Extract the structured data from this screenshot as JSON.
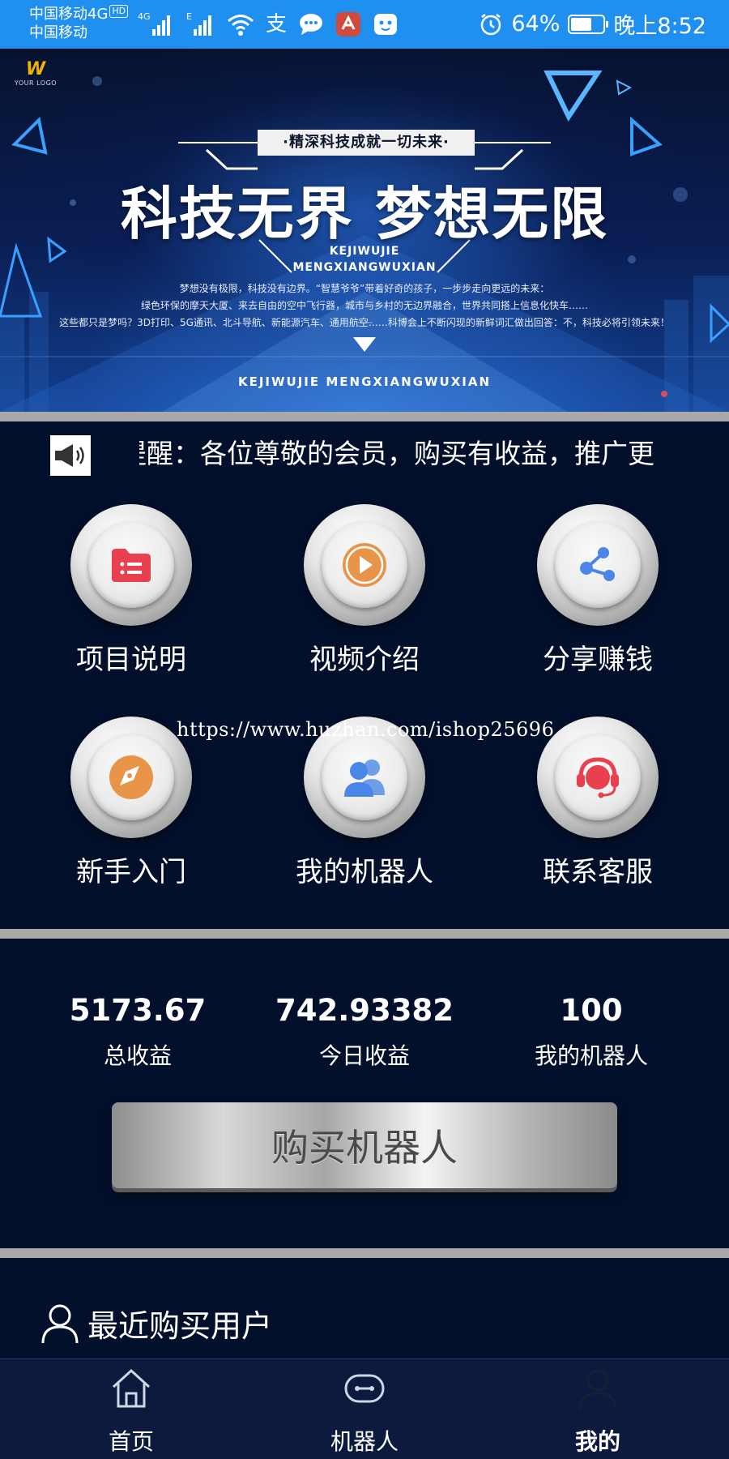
{
  "status_bar": {
    "carrier_1": "中国移动4G",
    "hd_badge": "HD",
    "carrier_2": "中国移动",
    "net_tag_1": "4G",
    "net_tag_2": "E",
    "alipay_glyph": "支",
    "battery_text": "64%",
    "battery_level": 0.64,
    "time": "晚上8:52"
  },
  "banner": {
    "logo_text": "YOUR LOGO",
    "tag": "·精深科技成就一切未来·",
    "title": "科技无界 梦想无限",
    "pinyin_1": "KEJIWUJIE",
    "pinyin_2": "MENGXIANGWUXIAN",
    "desc_1": "梦想没有极限，科技没有边界。“智慧爷爷”带着好奇的孩子，一步步走向更远的未来：",
    "desc_2": "绿色环保的摩天大厦、来去自由的空中飞行器，城市与乡村的无边界融合，世界共同搭上信息化快车……",
    "desc_3": "这些都只是梦吗？3D打印、5G通讯、北斗导航、新能源汽车、通用航空……科博会上不断闪现的新鲜词汇做出回答：不，科技必将引领未来！",
    "footer": "KEJIWUJIE MENGXIANGWUXIAN"
  },
  "notice": {
    "icon": "megaphone-icon",
    "text": "提醒：各位尊敬的会员，购买有收益，推广更"
  },
  "menu": [
    {
      "label": "项目说明",
      "icon": "folder-list-icon",
      "color": "#e8404f"
    },
    {
      "label": "视频介绍",
      "icon": "play-icon",
      "color": "#e8954a"
    },
    {
      "label": "分享赚钱",
      "icon": "share-icon",
      "color": "#4a86e8"
    },
    {
      "label": "新手入门",
      "icon": "compass-icon",
      "color": "#e8954a"
    },
    {
      "label": "我的机器人",
      "icon": "users-icon",
      "color": "#4a86e8"
    },
    {
      "label": "联系客服",
      "icon": "headset-icon",
      "color": "#e8404f"
    }
  ],
  "watermark": "https://www.huzhan.com/ishop25696",
  "stats": [
    {
      "value": "5173.67",
      "label": "总收益"
    },
    {
      "value": "742.93382",
      "label": "今日收益"
    },
    {
      "value": "100",
      "label": "我的机器人"
    }
  ],
  "buy_button": "购买机器人",
  "recent": {
    "icon": "user-icon",
    "title": "最近购买用户"
  },
  "nav": [
    {
      "label": "首页",
      "icon": "home-icon",
      "active": false
    },
    {
      "label": "机器人",
      "icon": "robot-icon",
      "active": false
    },
    {
      "label": "我的",
      "icon": "profile-icon",
      "active": true
    }
  ],
  "colors": {
    "status_bar": "#1f8ff0",
    "page_background": "#03102c",
    "separator": "#a9a9a9",
    "nav_background": "#0c1a3e"
  }
}
